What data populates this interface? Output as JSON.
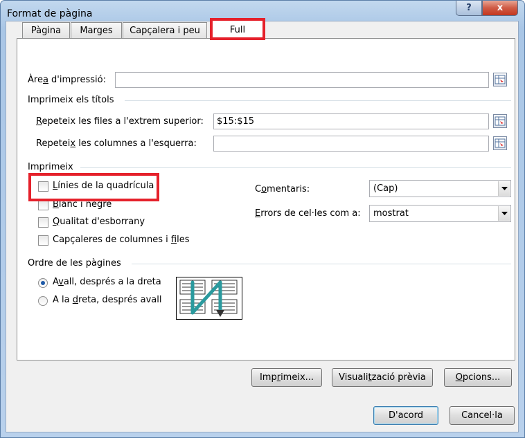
{
  "window": {
    "title": "Format de pàgina",
    "help": "?",
    "close": "x"
  },
  "tabs": [
    {
      "label": "Pàgina"
    },
    {
      "label": "Marges"
    },
    {
      "label": "Capçalera i peu"
    },
    {
      "label": "Full"
    }
  ],
  "print_area": {
    "label_pre": "Àre",
    "label_key": "a",
    "label_post": " d'impressió:",
    "value": ""
  },
  "print_titles": {
    "heading": "Imprimeix els títols",
    "rows": {
      "label_pre": "",
      "label_key": "R",
      "label_post": "epeteix les files a l'extrem superior:",
      "value": "$15:$15"
    },
    "cols": {
      "label_pre": "Repetei",
      "label_key": "x",
      "label_post": " les columnes a l'esquerra:",
      "value": ""
    }
  },
  "print": {
    "heading": "Imprimeix",
    "gridlines": {
      "label_pre": "",
      "label_key": "L",
      "label_post": "ínies de la quadrícula"
    },
    "blackwhite": {
      "label_pre": "",
      "label_key": "B",
      "label_post": "lanc i negre"
    },
    "draft": {
      "label_pre": "",
      "label_key": "Q",
      "label_post": "ualitat d'esborrany"
    },
    "headings": {
      "label_pre": "Capçaleres de columnes i ",
      "label_key": "f",
      "label_post": "iles"
    },
    "comments": {
      "label_pre": "C",
      "label_key": "o",
      "label_post": "mentaris:",
      "value": "(Cap)"
    },
    "errors": {
      "label_pre": "",
      "label_key": "E",
      "label_post": "rrors de cel·les com a:",
      "value": "mostrat"
    }
  },
  "page_order": {
    "heading": "Ordre de les pàgines",
    "down": {
      "label_pre": "A",
      "label_key": "v",
      "label_post": "all, després a la dreta"
    },
    "over": {
      "label_pre": "A la ",
      "label_key": "d",
      "label_post": "reta, després avall"
    }
  },
  "buttons": {
    "print": {
      "label_pre": "Imp",
      "label_key": "r",
      "label_post": "imeix..."
    },
    "preview": {
      "label_pre": "Visuali",
      "label_key": "t",
      "label_post": "zació prèvia"
    },
    "options": {
      "label_pre": "",
      "label_key": "O",
      "label_post": "pcions..."
    },
    "ok": "D'acord",
    "cancel": "Cancel·la"
  },
  "colors": {
    "highlight": "#e5212b",
    "accent": "#1e5aa8",
    "arrow": "#2a9a9e"
  }
}
